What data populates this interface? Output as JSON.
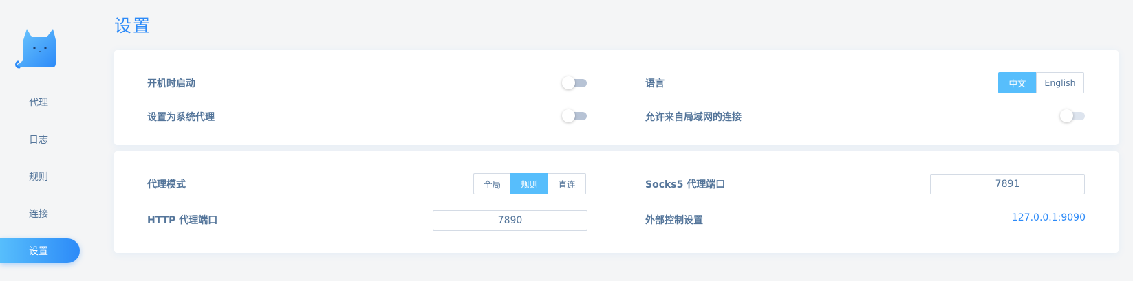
{
  "sidebar": {
    "items": [
      {
        "label": "代理"
      },
      {
        "label": "日志"
      },
      {
        "label": "规则"
      },
      {
        "label": "连接"
      },
      {
        "label": "设置",
        "active": true
      }
    ]
  },
  "page": {
    "title": "设置"
  },
  "general": {
    "startup_label": "开机时启动",
    "startup_on": false,
    "system_proxy_label": "设置为系统代理",
    "system_proxy_on": false,
    "language_label": "语言",
    "language_options": [
      "中文",
      "English"
    ],
    "language_selected": "中文",
    "allow_lan_label": "允许来自局域网的连接",
    "allow_lan_on": false
  },
  "proxy": {
    "mode_label": "代理模式",
    "mode_options": [
      "全局",
      "规则",
      "直连"
    ],
    "mode_selected": "规则",
    "http_port_label": "HTTP 代理端口",
    "http_port_value": "7890",
    "socks_port_label": "Socks5 代理端口",
    "socks_port_value": "7891",
    "external_control_label": "外部控制设置",
    "external_control_value": "127.0.0.1:9090"
  },
  "colors": {
    "accent": "#2c8af8",
    "accent_light": "#57befc",
    "text": "#54759a",
    "background": "#f4f5f6"
  }
}
